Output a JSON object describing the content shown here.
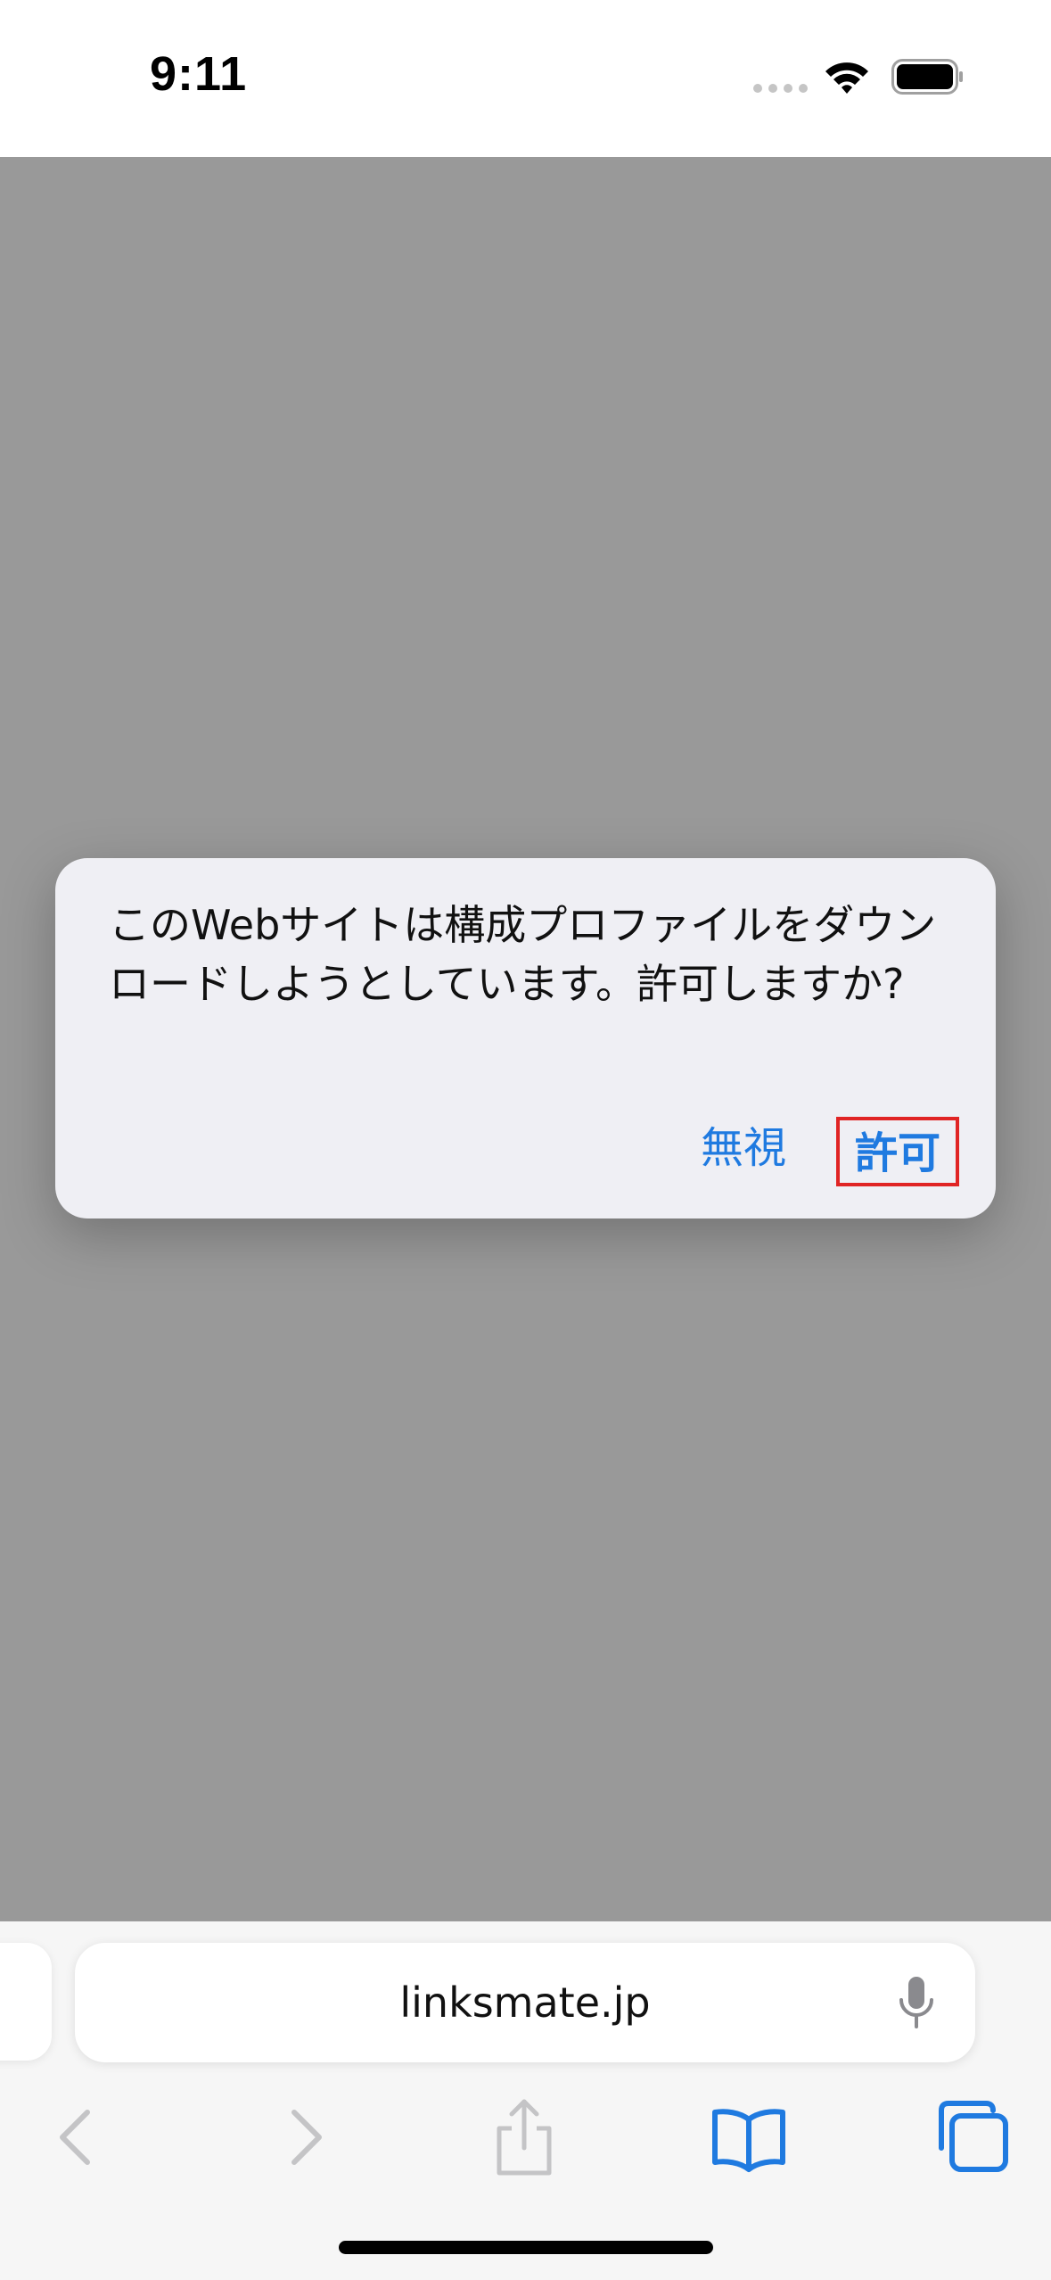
{
  "status_bar": {
    "time": "9:11"
  },
  "dialog": {
    "message": "このWebサイトは構成プロファイルをダウンロードしようとしています。許可しますか?",
    "ignore_label": "無視",
    "allow_label": "許可",
    "highlight_color": "#e02424"
  },
  "address_bar": {
    "url": "linksmate.jp"
  },
  "toolbar": {
    "icons": [
      "back-icon",
      "forward-icon",
      "share-icon",
      "bookmarks-icon",
      "tabs-icon"
    ],
    "accent_color": "#1f7ae0"
  }
}
